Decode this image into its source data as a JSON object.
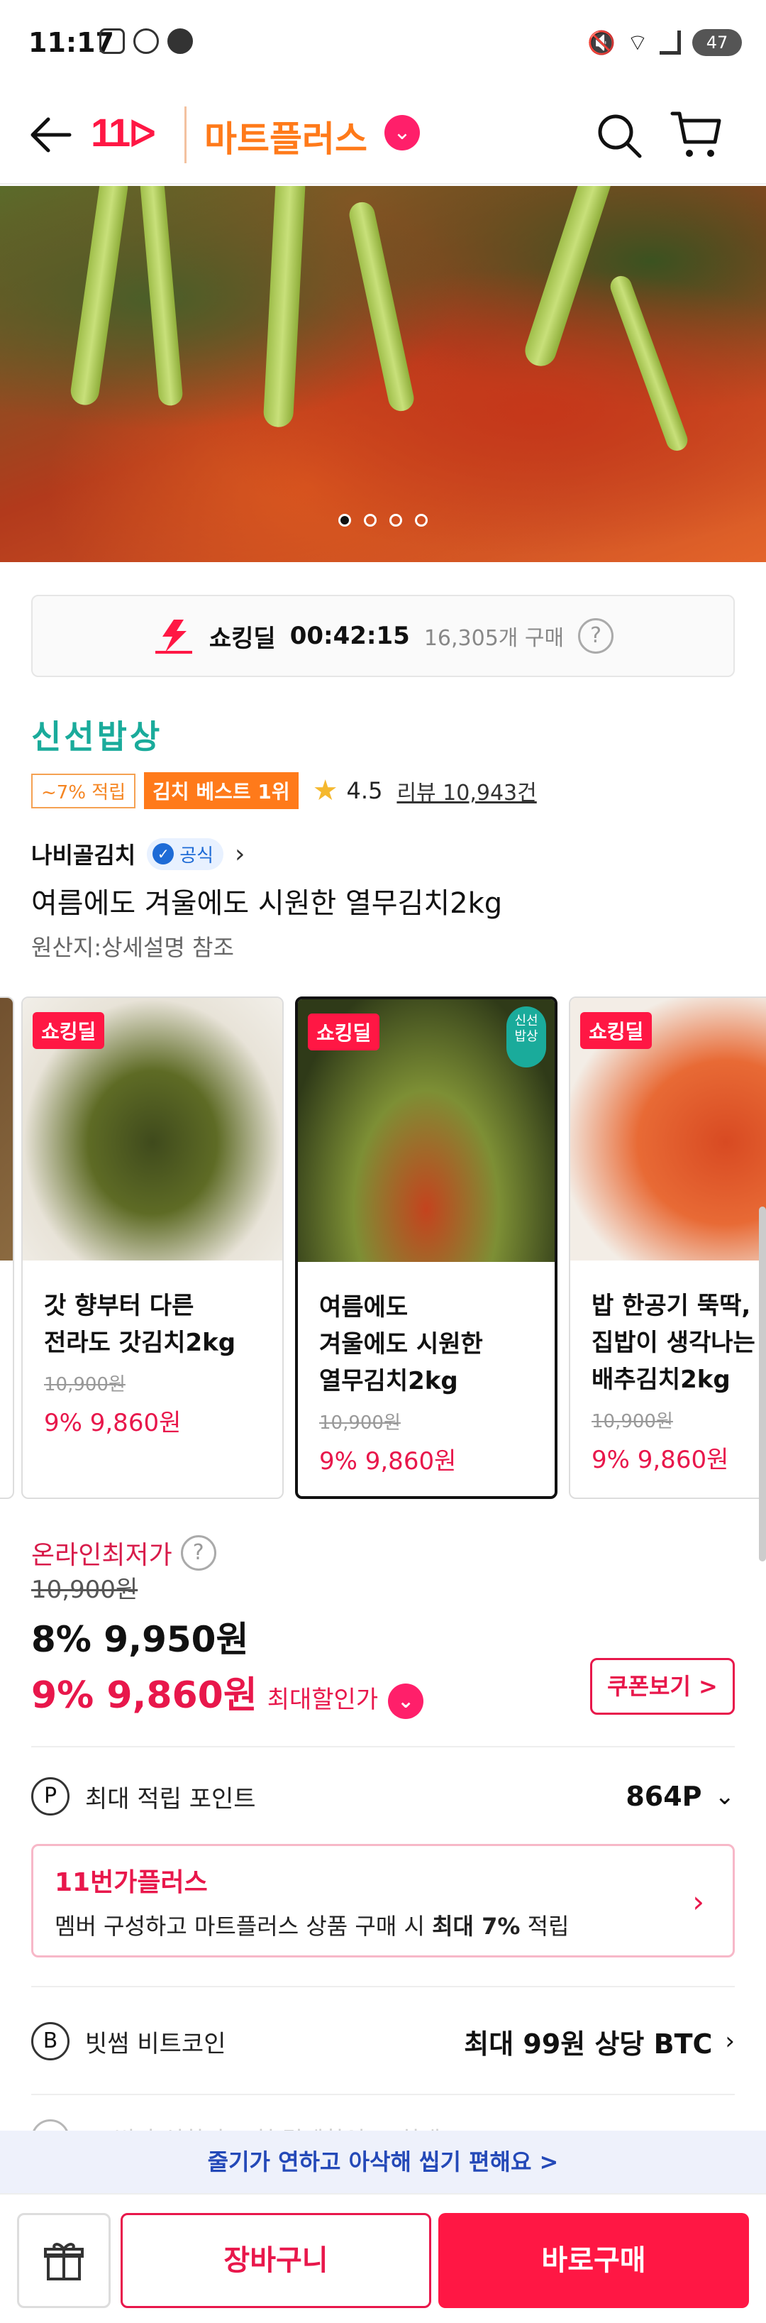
{
  "status_bar": {
    "time": "11:17",
    "battery": "47"
  },
  "header": {
    "logo": "11",
    "brand": "마트플러스"
  },
  "hero": {
    "slide_count": 4,
    "active_slide": 1
  },
  "deal": {
    "label": "쇼킹딜",
    "timer": "00:42:15",
    "purchase_count": "16,305개 구매",
    "help": "?"
  },
  "store": {
    "name": "신선밥상"
  },
  "badges": {
    "point": "~7% 적립",
    "best": "김치 베스트 1위",
    "rating": "4.5",
    "reviews": "리뷰 10,943건"
  },
  "seller": {
    "name": "나비골김치",
    "official": "공식"
  },
  "product": {
    "title": "여름에도 겨울에도 시원한 열무김치2kg",
    "origin": "원산지:상세설명 참조"
  },
  "carousel": [
    {
      "badge": "쇼킹딜",
      "name": "갓 향부터 다른\n전라도 갓김치2kg",
      "orig_price": "10,900원",
      "price": "9% 9,860원"
    },
    {
      "badge": "쇼킹딜",
      "name": "여름에도\n겨울에도 시원한\n열무김치2kg",
      "orig_price": "10,900원",
      "price": "9% 9,860원",
      "sticker": "신선\n밥상"
    },
    {
      "badge": "쇼킹딜",
      "name": "밥 한공기 뚝딱,\n집밥이 생각나는\n배추김치2kg",
      "orig_price": "10,900원",
      "price": "9% 9,860원"
    }
  ],
  "pricing": {
    "lowest_label": "온라인최저가",
    "original": "10,900원",
    "discounted": "8% 9,950원",
    "max_price": "9% 9,860원",
    "max_label": "최대할인가",
    "coupon_button": "쿠폰보기 >"
  },
  "point": {
    "icon": "P",
    "label": "최대 적립 포인트",
    "value": "864P"
  },
  "plus": {
    "title": "11번가플러스",
    "desc_prefix": "멤버 구성하고 마트플러스 상품 구매 시 ",
    "desc_bold": "최대 7%",
    "desc_suffix": " 적립"
  },
  "btc": {
    "icon": "B",
    "label": "빗썸 비트코인",
    "value": "최대 99원 상당 BTC"
  },
  "partial_row": {
    "text": "11번가 신한카드 첫 결제할인 + 최대 ..."
  },
  "tip": {
    "text": "줄기가 연하고 아삭해 씹기 편해요 >"
  },
  "bottom": {
    "cart": "장바구니",
    "buy": "바로구매"
  },
  "colors": {
    "brand_red": "#ff1744",
    "brand_orange": "#ff7a1a",
    "teal": "#1aab9b",
    "price_red": "#e8174b"
  }
}
